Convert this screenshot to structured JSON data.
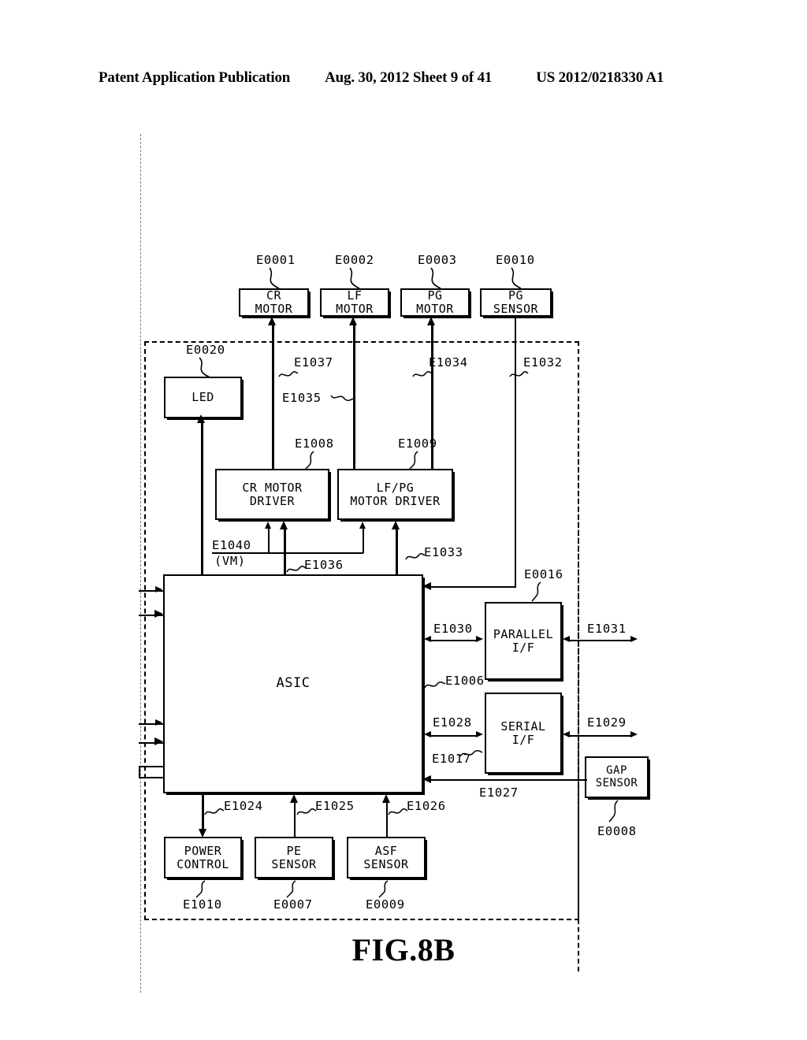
{
  "header": {
    "publication": "Patent Application Publication",
    "date_sheet": "Aug. 30, 2012  Sheet 9 of 41",
    "patent_number": "US 2012/0218330 A1"
  },
  "figure": {
    "caption": "FIG.8B"
  },
  "blocks": {
    "cr_motor": "CR\nMOTOR",
    "lf_motor": "LF\nMOTOR",
    "pg_motor": "PG\nMOTOR",
    "pg_sensor": "PG\nSENSOR",
    "led": "LED",
    "cr_motor_driver": "CR MOTOR\nDRIVER",
    "lf_pg_motor_driver": "LF/PG\nMOTOR DRIVER",
    "asic": "ASIC",
    "parallel_if": "PARALLEL\nI/F",
    "serial_if": "SERIAL\nI/F",
    "gap_sensor": "GAP\nSENSOR",
    "power_control": "POWER\nCONTROL",
    "pe_sensor": "PE\nSENSOR",
    "asf_sensor": "ASF\nSENSOR"
  },
  "refs": {
    "e0001": "E0001",
    "e0002": "E0002",
    "e0003": "E0003",
    "e0010": "E0010",
    "e0020": "E0020",
    "e0016": "E0016",
    "e0008": "E0008",
    "e0007": "E0007",
    "e0009": "E0009",
    "e1006": "E1006",
    "e1008": "E1008",
    "e1009": "E1009",
    "e1010": "E1010",
    "e1017": "E1017",
    "e1024": "E1024",
    "e1025": "E1025",
    "e1026": "E1026",
    "e1027": "E1027",
    "e1028": "E1028",
    "e1029": "E1029",
    "e1030": "E1030",
    "e1031": "E1031",
    "e1032": "E1032",
    "e1033": "E1033",
    "e1034": "E1034",
    "e1035": "E1035",
    "e1036": "E1036",
    "e1037": "E1037",
    "e1040": "E1040",
    "e1040_sub": "(VM)"
  },
  "colors": {
    "ink": "#000000",
    "paper": "#ffffff",
    "margin_rule": "#7a7a7a"
  }
}
